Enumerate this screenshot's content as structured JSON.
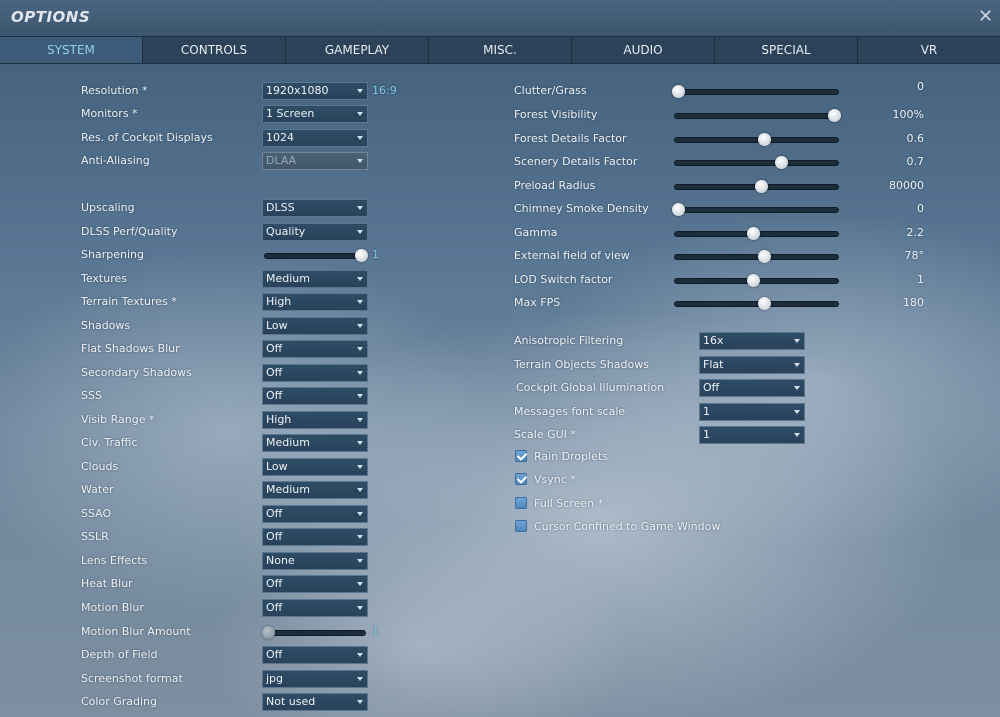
{
  "window": {
    "title": "OPTIONS",
    "close_glyph": "✕"
  },
  "tabs": [
    {
      "label": "SYSTEM",
      "active": true
    },
    {
      "label": "CONTROLS"
    },
    {
      "label": "GAMEPLAY"
    },
    {
      "label": "MISC."
    },
    {
      "label": "AUDIO"
    },
    {
      "label": "SPECIAL"
    },
    {
      "label": "VR"
    }
  ],
  "left": {
    "resolution": {
      "label": "Resolution *",
      "value": "1920x1080",
      "aspect": "16:9"
    },
    "monitors": {
      "label": "Monitors *",
      "value": "1 Screen"
    },
    "cockpit_res": {
      "label": "Res. of Cockpit Displays",
      "value": "1024"
    },
    "anti_aliasing": {
      "label": "Anti-Aliasing",
      "value": "DLAA"
    },
    "upscaling": {
      "label": "Upscaling",
      "value": "DLSS"
    },
    "dlss_quality": {
      "label": "DLSS Perf/Quality",
      "value": "Quality"
    },
    "sharpening": {
      "label": "Sharpening",
      "value": "1",
      "level": 1.0
    },
    "textures": {
      "label": "Textures",
      "value": "Medium"
    },
    "terrain_textures": {
      "label": "Terrain Textures *",
      "value": "High"
    },
    "shadows": {
      "label": "Shadows",
      "value": "Low"
    },
    "flat_shadows_blur": {
      "label": "Flat Shadows Blur",
      "value": "Off"
    },
    "secondary_shadows": {
      "label": "Secondary Shadows",
      "value": "Off"
    },
    "sss": {
      "label": "SSS",
      "value": "Off"
    },
    "visib_range": {
      "label": "Visib Range *",
      "value": "High"
    },
    "civ_traffic": {
      "label": "Civ. Traffic",
      "value": "Medium"
    },
    "clouds": {
      "label": "Clouds",
      "value": "Low"
    },
    "water": {
      "label": "Water",
      "value": "Medium"
    },
    "ssao": {
      "label": "SSAO",
      "value": "Off"
    },
    "sslr": {
      "label": "SSLR",
      "value": "Off"
    },
    "lens_effects": {
      "label": "Lens Effects",
      "value": "None"
    },
    "heat_blur": {
      "label": "Heat Blur",
      "value": "Off"
    },
    "motion_blur": {
      "label": "Motion Blur",
      "value": "Off"
    },
    "motion_blur_amount": {
      "label": "Motion Blur Amount",
      "value": "1",
      "level": 0.0
    },
    "depth_of_field": {
      "label": "Depth of Field",
      "value": "Off"
    },
    "screenshot_format": {
      "label": "Screenshot format",
      "value": "jpg"
    },
    "color_grading": {
      "label": "Color Grading",
      "value": "Not used"
    }
  },
  "right": {
    "clutter_grass": {
      "label": "Clutter/Grass",
      "value": "0",
      "level": 0.0
    },
    "forest_visibility": {
      "label": "Forest Visibility",
      "value": "100%",
      "level": 1.0
    },
    "forest_details": {
      "label": "Forest Details Factor",
      "value": "0.6",
      "level": 0.55
    },
    "scenery_details": {
      "label": "Scenery Details Factor",
      "value": "0.7",
      "level": 0.66
    },
    "preload_radius": {
      "label": "Preload Radius",
      "value": "80000",
      "level": 0.53
    },
    "chimney_smoke": {
      "label": "Chimney Smoke Density",
      "value": "0",
      "level": 0.0
    },
    "gamma": {
      "label": "Gamma",
      "value": "2.2",
      "level": 0.48
    },
    "external_fov": {
      "label": "External field of view",
      "value": "78°",
      "level": 0.55
    },
    "lod_switch": {
      "label": "LOD Switch factor",
      "value": "1",
      "level": 0.48
    },
    "max_fps": {
      "label": "Max FPS",
      "value": "180",
      "level": 0.55
    },
    "anisotropic": {
      "label": "Anisotropic Filtering",
      "value": "16x"
    },
    "terrain_objects_shadows": {
      "label": "Terrain Objects Shadows",
      "value": "Flat"
    },
    "cockpit_gi": {
      "label": "Cockpit Global Illumination",
      "value": "Off"
    },
    "messages_font_scale": {
      "label": "Messages font scale",
      "value": "1"
    },
    "scale_gui": {
      "label": "Scale GUI *",
      "value": "1"
    },
    "rain_droplets": {
      "label": "Rain Droplets",
      "checked": true
    },
    "vsync": {
      "label": "Vsync *",
      "checked": true
    },
    "full_screen": {
      "label": "Full Screen *",
      "checked": false
    },
    "cursor_confined": {
      "label": "Cursor Confined to Game Window",
      "checked": false
    }
  }
}
